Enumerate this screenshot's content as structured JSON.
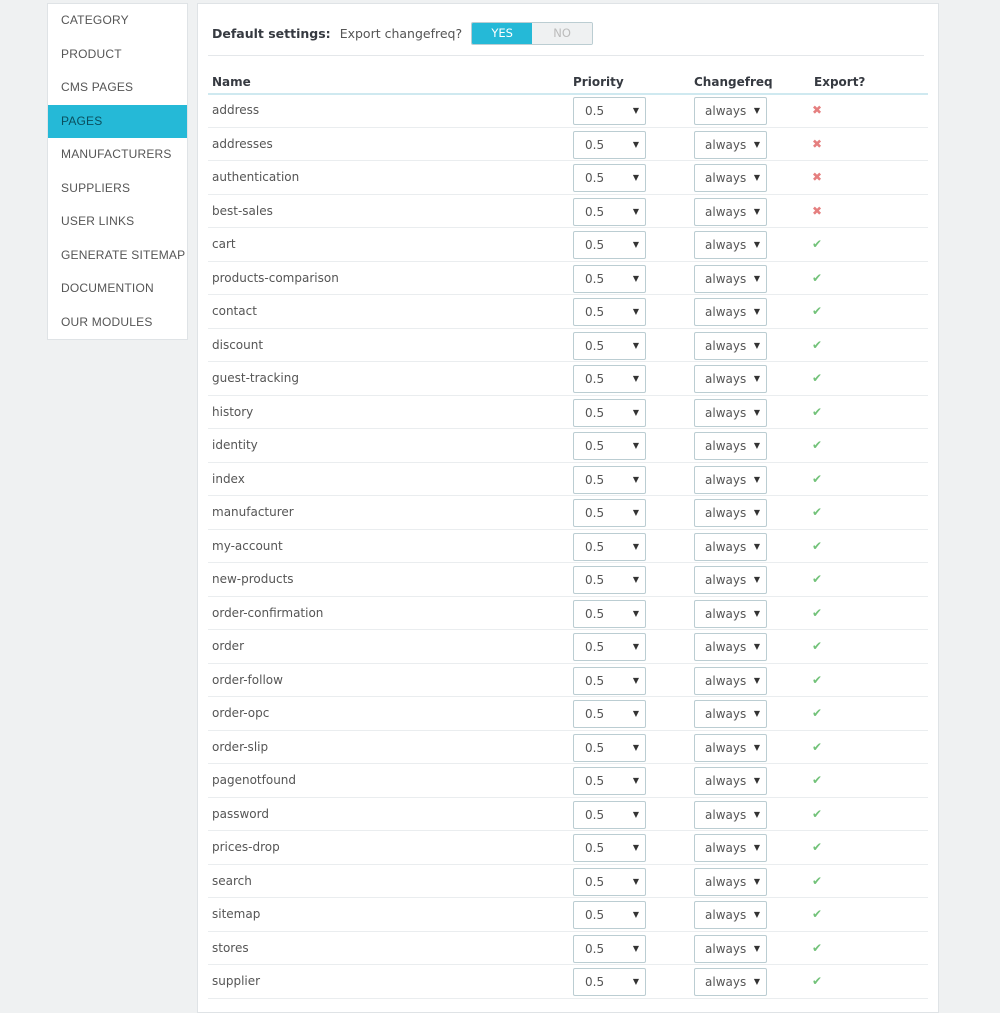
{
  "sidebar": {
    "items": [
      {
        "label": "CATEGORY"
      },
      {
        "label": "PRODUCT"
      },
      {
        "label": "CMS PAGES"
      },
      {
        "label": "PAGES",
        "active": true
      },
      {
        "label": "MANUFACTURERS"
      },
      {
        "label": "SUPPLIERS"
      },
      {
        "label": "USER LINKS"
      },
      {
        "label": "GENERATE SITEMAP"
      },
      {
        "label": "DOCUMENTION"
      },
      {
        "label": "OUR MODULES"
      }
    ]
  },
  "settings": {
    "title": "Default settings:",
    "export_label": "Export changefreq?",
    "yes": "YES",
    "no": "NO",
    "selected": "YES"
  },
  "table": {
    "columns": {
      "name": "Name",
      "priority": "Priority",
      "changefreq": "Changefreq",
      "export": "Export?"
    },
    "rows": [
      {
        "name": "address",
        "priority": "0.5",
        "changefreq": "always",
        "export": false
      },
      {
        "name": "addresses",
        "priority": "0.5",
        "changefreq": "always",
        "export": false
      },
      {
        "name": "authentication",
        "priority": "0.5",
        "changefreq": "always",
        "export": false
      },
      {
        "name": "best-sales",
        "priority": "0.5",
        "changefreq": "always",
        "export": false
      },
      {
        "name": "cart",
        "priority": "0.5",
        "changefreq": "always",
        "export": true
      },
      {
        "name": "products-comparison",
        "priority": "0.5",
        "changefreq": "always",
        "export": true
      },
      {
        "name": "contact",
        "priority": "0.5",
        "changefreq": "always",
        "export": true
      },
      {
        "name": "discount",
        "priority": "0.5",
        "changefreq": "always",
        "export": true
      },
      {
        "name": "guest-tracking",
        "priority": "0.5",
        "changefreq": "always",
        "export": true
      },
      {
        "name": "history",
        "priority": "0.5",
        "changefreq": "always",
        "export": true
      },
      {
        "name": "identity",
        "priority": "0.5",
        "changefreq": "always",
        "export": true
      },
      {
        "name": "index",
        "priority": "0.5",
        "changefreq": "always",
        "export": true
      },
      {
        "name": "manufacturer",
        "priority": "0.5",
        "changefreq": "always",
        "export": true
      },
      {
        "name": "my-account",
        "priority": "0.5",
        "changefreq": "always",
        "export": true
      },
      {
        "name": "new-products",
        "priority": "0.5",
        "changefreq": "always",
        "export": true
      },
      {
        "name": "order-confirmation",
        "priority": "0.5",
        "changefreq": "always",
        "export": true
      },
      {
        "name": "order",
        "priority": "0.5",
        "changefreq": "always",
        "export": true
      },
      {
        "name": "order-follow",
        "priority": "0.5",
        "changefreq": "always",
        "export": true
      },
      {
        "name": "order-opc",
        "priority": "0.5",
        "changefreq": "always",
        "export": true
      },
      {
        "name": "order-slip",
        "priority": "0.5",
        "changefreq": "always",
        "export": true
      },
      {
        "name": "pagenotfound",
        "priority": "0.5",
        "changefreq": "always",
        "export": true
      },
      {
        "name": "password",
        "priority": "0.5",
        "changefreq": "always",
        "export": true
      },
      {
        "name": "prices-drop",
        "priority": "0.5",
        "changefreq": "always",
        "export": true
      },
      {
        "name": "search",
        "priority": "0.5",
        "changefreq": "always",
        "export": true
      },
      {
        "name": "sitemap",
        "priority": "0.5",
        "changefreq": "always",
        "export": true
      },
      {
        "name": "stores",
        "priority": "0.5",
        "changefreq": "always",
        "export": true
      },
      {
        "name": "supplier",
        "priority": "0.5",
        "changefreq": "always",
        "export": true
      }
    ]
  },
  "icons": {
    "export_yes": "check-icon",
    "export_no": "cross-icon",
    "dropdown": "caret-down-icon"
  },
  "colors": {
    "accent": "#25b9d7",
    "export_yes": "#72c279",
    "export_no": "#e57f7f"
  }
}
